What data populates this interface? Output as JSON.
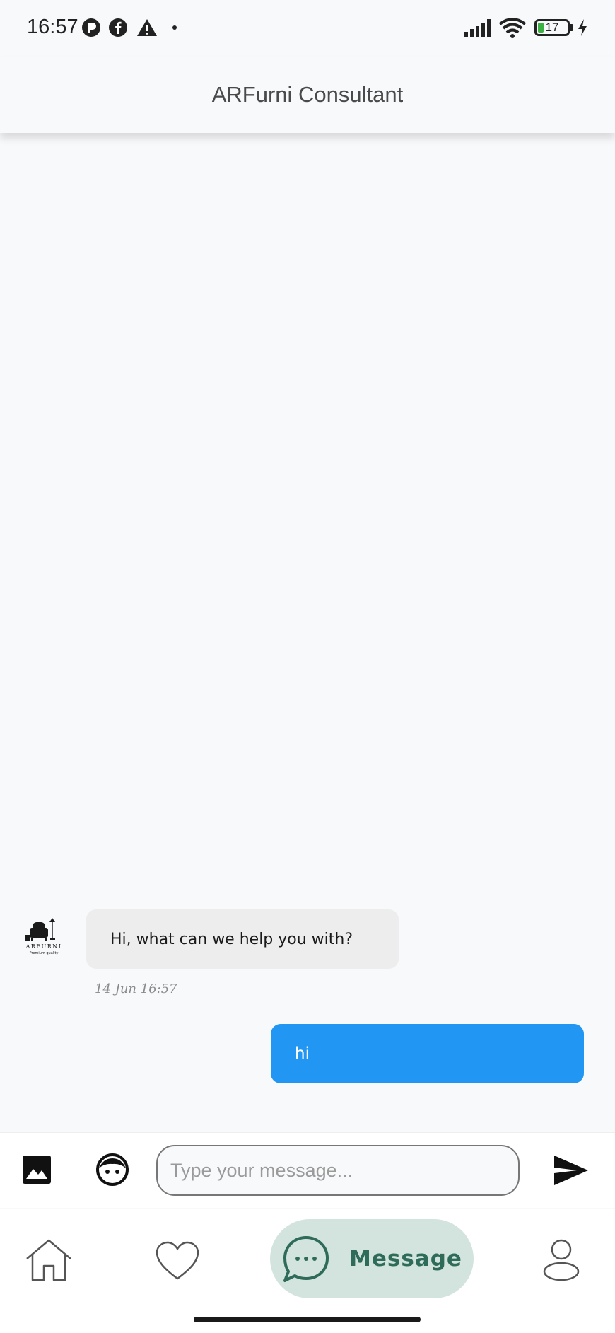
{
  "status_bar": {
    "time": "16:57",
    "notification_icons": [
      "p-app-icon",
      "facebook-icon",
      "warning-icon",
      "dot-icon"
    ],
    "battery_level": "17",
    "system_icons": [
      "signal-icon",
      "wifi-icon",
      "battery-icon",
      "charging-icon"
    ]
  },
  "app_bar": {
    "title": "ARFurni Consultant"
  },
  "chat": {
    "bot_avatar": {
      "brand": "ARFURNI",
      "tagline": "Premium quality"
    },
    "messages": [
      {
        "sender": "bot",
        "text": "Hi, what can we help you with?",
        "time": "14 Jun 16:57"
      },
      {
        "sender": "user",
        "text": "hi"
      }
    ]
  },
  "composer": {
    "placeholder": "Type your message...",
    "value": "",
    "icons": [
      "image-icon",
      "emoji-icon",
      "send-icon"
    ]
  },
  "bottom_nav": {
    "items": [
      {
        "id": "home",
        "icon": "home-icon",
        "label": ""
      },
      {
        "id": "favorites",
        "icon": "heart-icon",
        "label": ""
      },
      {
        "id": "message",
        "icon": "chat-bubble-icon",
        "label": "Message",
        "active": true
      },
      {
        "id": "profile",
        "icon": "user-icon",
        "label": ""
      }
    ]
  },
  "colors": {
    "user_bubble": "#2196f3",
    "bot_bubble": "#ededed",
    "active_nav_bg": "#d3e4df",
    "active_nav_fg": "#2e6b58"
  }
}
